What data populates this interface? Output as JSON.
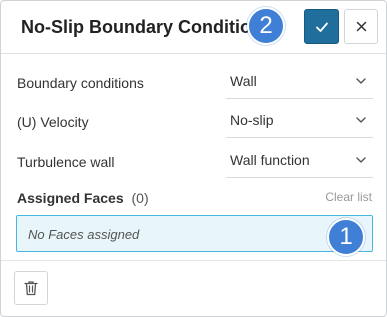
{
  "header": {
    "title": "No-Slip Boundary Condition",
    "step_badge_top": "2",
    "confirm_icon": "check-icon",
    "close_icon": "close-icon"
  },
  "fields": [
    {
      "label": "Boundary conditions",
      "value": "Wall"
    },
    {
      "label": "(U) Velocity",
      "value": "No-slip"
    },
    {
      "label": "Turbulence wall",
      "value": "Wall function"
    }
  ],
  "assigned_faces": {
    "title": "Assigned Faces",
    "count": "(0)",
    "clear_label": "Clear list",
    "empty_text": "No Faces assigned",
    "step_badge": "1"
  },
  "footer": {
    "delete_icon": "trash-icon"
  },
  "colors": {
    "accent_badge": "#3f7fd6",
    "confirm_button": "#1f6e9c",
    "faces_box_bg": "#e8f5fb",
    "faces_box_border": "#49b6df"
  }
}
